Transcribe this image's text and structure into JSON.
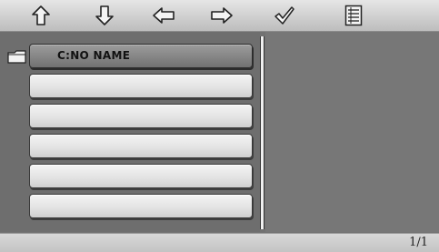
{
  "toolbar": {
    "buttons": [
      {
        "icon": "up-arrow-icon"
      },
      {
        "icon": "down-arrow-icon"
      },
      {
        "icon": "left-arrow-icon"
      },
      {
        "icon": "right-arrow-icon"
      },
      {
        "icon": "checkmark-icon"
      },
      {
        "icon": "list-icon"
      }
    ]
  },
  "file_list": {
    "folder_icon": "folder-icon",
    "items": [
      {
        "label": "C:NO NAME",
        "selected": true
      },
      {
        "label": "",
        "selected": false
      },
      {
        "label": "",
        "selected": false
      },
      {
        "label": "",
        "selected": false
      },
      {
        "label": "",
        "selected": false
      },
      {
        "label": "",
        "selected": false
      }
    ]
  },
  "status": {
    "page": "1/1"
  }
}
